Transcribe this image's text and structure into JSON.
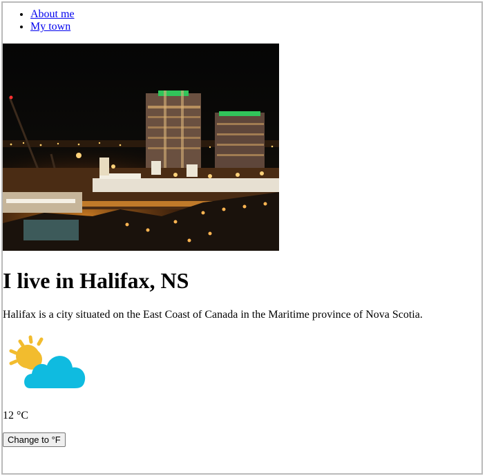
{
  "nav": {
    "items": [
      {
        "label": "About me"
      },
      {
        "label": "My town"
      }
    ]
  },
  "hero": {
    "image_icon": "halifax-night-skyline-photo"
  },
  "main": {
    "title": "I live in Halifax, NS",
    "description": "Halifax is a city situated on the East Coast of Canada in the Maritime province of Nova Scotia."
  },
  "weather": {
    "icon": "partly-cloudy-icon",
    "temperature": "12 °C",
    "toggle_label": "Change to °F",
    "colors": {
      "sun": "#f2bc2e",
      "cloud": "#0fbbe0"
    }
  }
}
